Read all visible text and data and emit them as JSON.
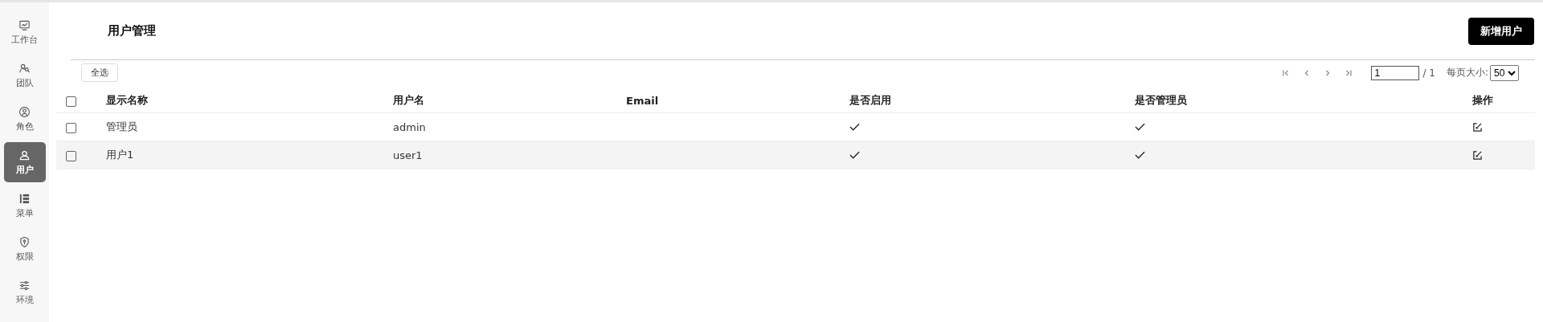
{
  "sidebar": {
    "items": [
      {
        "label": "工作台",
        "selected": false
      },
      {
        "label": "团队",
        "selected": false
      },
      {
        "label": "角色",
        "selected": false
      },
      {
        "label": "用户",
        "selected": true
      },
      {
        "label": "菜单",
        "selected": false
      },
      {
        "label": "权限",
        "selected": false
      },
      {
        "label": "环境",
        "selected": false
      }
    ]
  },
  "page": {
    "title": "用户管理",
    "add_button": "新增用户"
  },
  "toolbar": {
    "select_all": "全选",
    "pager": {
      "page": "1",
      "total": "/ 1",
      "page_size_label": "每页大小:",
      "page_size": "50"
    }
  },
  "table": {
    "header_checked": false,
    "columns": [
      "显示名称",
      "用户名",
      "Email",
      "是否启用",
      "是否管理员",
      "操作"
    ],
    "rows": [
      {
        "checked": false,
        "display_name": "管理员",
        "username": "admin",
        "enabled": true,
        "admin": true
      },
      {
        "checked": false,
        "display_name": "用户1",
        "username": "user1",
        "enabled": true,
        "admin": true
      }
    ]
  }
}
